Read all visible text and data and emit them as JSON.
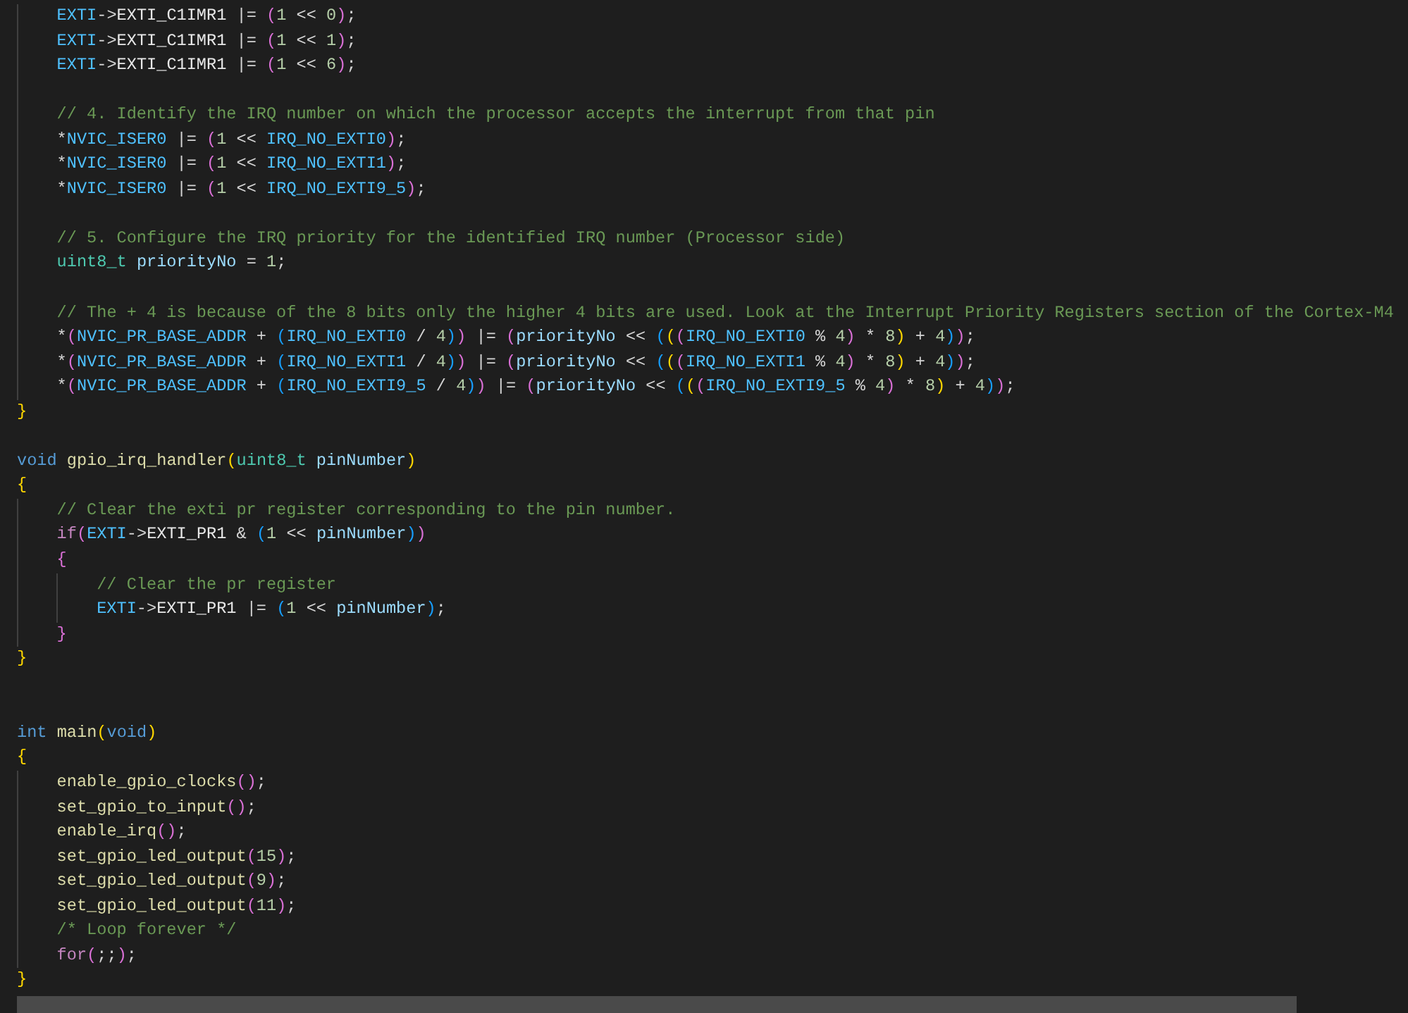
{
  "editor": {
    "lines": [
      {
        "kind": "block",
        "children": [
          {
            "kind": "code",
            "tokens": [
              {
                "text": "EXTI",
                "kind": "mac"
              },
              {
                "text": "->",
                "kind": "op"
              },
              {
                "text": "EXTI_C1IMR1",
                "kind": "fld"
              },
              {
                "text": " |= ",
                "kind": "op"
              },
              {
                "text": "(",
                "kind": "b2"
              },
              {
                "text": "1",
                "kind": "num"
              },
              {
                "text": " << ",
                "kind": "op"
              },
              {
                "text": "0",
                "kind": "num"
              },
              {
                "text": ")",
                "kind": "b2"
              },
              {
                "text": ";",
                "kind": "op"
              }
            ]
          },
          {
            "kind": "code",
            "tokens": [
              {
                "text": "EXTI",
                "kind": "mac"
              },
              {
                "text": "->",
                "kind": "op"
              },
              {
                "text": "EXTI_C1IMR1",
                "kind": "fld"
              },
              {
                "text": " |= ",
                "kind": "op"
              },
              {
                "text": "(",
                "kind": "b2"
              },
              {
                "text": "1",
                "kind": "num"
              },
              {
                "text": " << ",
                "kind": "op"
              },
              {
                "text": "1",
                "kind": "num"
              },
              {
                "text": ")",
                "kind": "b2"
              },
              {
                "text": ";",
                "kind": "op"
              }
            ]
          },
          {
            "kind": "code",
            "tokens": [
              {
                "text": "EXTI",
                "kind": "mac"
              },
              {
                "text": "->",
                "kind": "op"
              },
              {
                "text": "EXTI_C1IMR1",
                "kind": "fld"
              },
              {
                "text": " |= ",
                "kind": "op"
              },
              {
                "text": "(",
                "kind": "b2"
              },
              {
                "text": "1",
                "kind": "num"
              },
              {
                "text": " << ",
                "kind": "op"
              },
              {
                "text": "6",
                "kind": "num"
              },
              {
                "text": ")",
                "kind": "b2"
              },
              {
                "text": ";",
                "kind": "op"
              }
            ]
          },
          {
            "kind": "blank"
          },
          {
            "kind": "code",
            "tokens": [
              {
                "text": "// 4. Identify the IRQ number on which the processor accepts the interrupt from that pin",
                "kind": "cmt"
              }
            ]
          },
          {
            "kind": "code",
            "tokens": [
              {
                "text": "*",
                "kind": "op"
              },
              {
                "text": "NVIC_ISER0",
                "kind": "mac"
              },
              {
                "text": " |= ",
                "kind": "op"
              },
              {
                "text": "(",
                "kind": "b2"
              },
              {
                "text": "1",
                "kind": "num"
              },
              {
                "text": " << ",
                "kind": "op"
              },
              {
                "text": "IRQ_NO_EXTI0",
                "kind": "mac"
              },
              {
                "text": ")",
                "kind": "b2"
              },
              {
                "text": ";",
                "kind": "op"
              }
            ]
          },
          {
            "kind": "code",
            "tokens": [
              {
                "text": "*",
                "kind": "op"
              },
              {
                "text": "NVIC_ISER0",
                "kind": "mac"
              },
              {
                "text": " |= ",
                "kind": "op"
              },
              {
                "text": "(",
                "kind": "b2"
              },
              {
                "text": "1",
                "kind": "num"
              },
              {
                "text": " << ",
                "kind": "op"
              },
              {
                "text": "IRQ_NO_EXTI1",
                "kind": "mac"
              },
              {
                "text": ")",
                "kind": "b2"
              },
              {
                "text": ";",
                "kind": "op"
              }
            ]
          },
          {
            "kind": "code",
            "tokens": [
              {
                "text": "*",
                "kind": "op"
              },
              {
                "text": "NVIC_ISER0",
                "kind": "mac"
              },
              {
                "text": " |= ",
                "kind": "op"
              },
              {
                "text": "(",
                "kind": "b2"
              },
              {
                "text": "1",
                "kind": "num"
              },
              {
                "text": " << ",
                "kind": "op"
              },
              {
                "text": "IRQ_NO_EXTI9_5",
                "kind": "mac"
              },
              {
                "text": ")",
                "kind": "b2"
              },
              {
                "text": ";",
                "kind": "op"
              }
            ]
          },
          {
            "kind": "blank"
          },
          {
            "kind": "code",
            "tokens": [
              {
                "text": "// 5. Configure the IRQ priority for the identified IRQ number (Processor side)",
                "kind": "cmt"
              }
            ]
          },
          {
            "kind": "code",
            "tokens": [
              {
                "text": "uint8_t ",
                "kind": "type"
              },
              {
                "text": "priorityNo",
                "kind": "var"
              },
              {
                "text": " = ",
                "kind": "op"
              },
              {
                "text": "1",
                "kind": "num"
              },
              {
                "text": ";",
                "kind": "op"
              }
            ]
          },
          {
            "kind": "blank"
          },
          {
            "kind": "code",
            "tokens": [
              {
                "text": "// The + 4 is because of the 8 bits only the higher 4 bits are used. Look at the Interrupt Priority Registers section of the Cortex-M4",
                "kind": "cmt"
              }
            ]
          },
          {
            "kind": "code",
            "tokens": [
              {
                "text": "*",
                "kind": "op"
              },
              {
                "text": "(",
                "kind": "b2"
              },
              {
                "text": "NVIC_PR_BASE_ADDR",
                "kind": "mac"
              },
              {
                "text": " + ",
                "kind": "op"
              },
              {
                "text": "(",
                "kind": "b3"
              },
              {
                "text": "IRQ_NO_EXTI0",
                "kind": "mac"
              },
              {
                "text": " / ",
                "kind": "op"
              },
              {
                "text": "4",
                "kind": "num"
              },
              {
                "text": ")",
                "kind": "b3"
              },
              {
                "text": ")",
                "kind": "b2"
              },
              {
                "text": " |= ",
                "kind": "op"
              },
              {
                "text": "(",
                "kind": "b2"
              },
              {
                "text": "priorityNo",
                "kind": "var"
              },
              {
                "text": " << ",
                "kind": "op"
              },
              {
                "text": "(",
                "kind": "b3"
              },
              {
                "text": "(",
                "kind": "b1"
              },
              {
                "text": "(",
                "kind": "b2"
              },
              {
                "text": "IRQ_NO_EXTI0",
                "kind": "mac"
              },
              {
                "text": " % ",
                "kind": "op"
              },
              {
                "text": "4",
                "kind": "num"
              },
              {
                "text": ")",
                "kind": "b2"
              },
              {
                "text": " * ",
                "kind": "op"
              },
              {
                "text": "8",
                "kind": "num"
              },
              {
                "text": ")",
                "kind": "b1"
              },
              {
                "text": " + ",
                "kind": "op"
              },
              {
                "text": "4",
                "kind": "num"
              },
              {
                "text": ")",
                "kind": "b3"
              },
              {
                "text": ")",
                "kind": "b2"
              },
              {
                "text": ";",
                "kind": "op"
              }
            ]
          },
          {
            "kind": "code",
            "tokens": [
              {
                "text": "*",
                "kind": "op"
              },
              {
                "text": "(",
                "kind": "b2"
              },
              {
                "text": "NVIC_PR_BASE_ADDR",
                "kind": "mac"
              },
              {
                "text": " + ",
                "kind": "op"
              },
              {
                "text": "(",
                "kind": "b3"
              },
              {
                "text": "IRQ_NO_EXTI1",
                "kind": "mac"
              },
              {
                "text": " / ",
                "kind": "op"
              },
              {
                "text": "4",
                "kind": "num"
              },
              {
                "text": ")",
                "kind": "b3"
              },
              {
                "text": ")",
                "kind": "b2"
              },
              {
                "text": " |= ",
                "kind": "op"
              },
              {
                "text": "(",
                "kind": "b2"
              },
              {
                "text": "priorityNo",
                "kind": "var"
              },
              {
                "text": " << ",
                "kind": "op"
              },
              {
                "text": "(",
                "kind": "b3"
              },
              {
                "text": "(",
                "kind": "b1"
              },
              {
                "text": "(",
                "kind": "b2"
              },
              {
                "text": "IRQ_NO_EXTI1",
                "kind": "mac"
              },
              {
                "text": " % ",
                "kind": "op"
              },
              {
                "text": "4",
                "kind": "num"
              },
              {
                "text": ")",
                "kind": "b2"
              },
              {
                "text": " * ",
                "kind": "op"
              },
              {
                "text": "8",
                "kind": "num"
              },
              {
                "text": ")",
                "kind": "b1"
              },
              {
                "text": " + ",
                "kind": "op"
              },
              {
                "text": "4",
                "kind": "num"
              },
              {
                "text": ")",
                "kind": "b3"
              },
              {
                "text": ")",
                "kind": "b2"
              },
              {
                "text": ";",
                "kind": "op"
              }
            ]
          },
          {
            "kind": "code",
            "tokens": [
              {
                "text": "*",
                "kind": "op"
              },
              {
                "text": "(",
                "kind": "b2"
              },
              {
                "text": "NVIC_PR_BASE_ADDR",
                "kind": "mac"
              },
              {
                "text": " + ",
                "kind": "op"
              },
              {
                "text": "(",
                "kind": "b3"
              },
              {
                "text": "IRQ_NO_EXTI9_5",
                "kind": "mac"
              },
              {
                "text": " / ",
                "kind": "op"
              },
              {
                "text": "4",
                "kind": "num"
              },
              {
                "text": ")",
                "kind": "b3"
              },
              {
                "text": ")",
                "kind": "b2"
              },
              {
                "text": " |= ",
                "kind": "op"
              },
              {
                "text": "(",
                "kind": "b2"
              },
              {
                "text": "priorityNo",
                "kind": "var"
              },
              {
                "text": " << ",
                "kind": "op"
              },
              {
                "text": "(",
                "kind": "b3"
              },
              {
                "text": "(",
                "kind": "b1"
              },
              {
                "text": "(",
                "kind": "b2"
              },
              {
                "text": "IRQ_NO_EXTI9_5",
                "kind": "mac"
              },
              {
                "text": " % ",
                "kind": "op"
              },
              {
                "text": "4",
                "kind": "num"
              },
              {
                "text": ")",
                "kind": "b2"
              },
              {
                "text": " * ",
                "kind": "op"
              },
              {
                "text": "8",
                "kind": "num"
              },
              {
                "text": ")",
                "kind": "b1"
              },
              {
                "text": " + ",
                "kind": "op"
              },
              {
                "text": "4",
                "kind": "num"
              },
              {
                "text": ")",
                "kind": "b3"
              },
              {
                "text": ")",
                "kind": "b2"
              },
              {
                "text": ";",
                "kind": "op"
              }
            ]
          }
        ]
      },
      {
        "kind": "code",
        "tokens": [
          {
            "text": "}",
            "kind": "b1"
          }
        ]
      },
      {
        "kind": "blank"
      },
      {
        "kind": "code",
        "tokens": [
          {
            "text": "void ",
            "kind": "kw"
          },
          {
            "text": "gpio_irq_handler",
            "kind": "fn"
          },
          {
            "text": "(",
            "kind": "b1"
          },
          {
            "text": "uint8_t ",
            "kind": "type"
          },
          {
            "text": "pinNumber",
            "kind": "var"
          },
          {
            "text": ")",
            "kind": "b1"
          }
        ]
      },
      {
        "kind": "code",
        "tokens": [
          {
            "text": "{",
            "kind": "b1"
          }
        ]
      },
      {
        "kind": "block",
        "children": [
          {
            "kind": "code",
            "tokens": [
              {
                "text": "// Clear the exti pr register corresponding to the pin number.",
                "kind": "cmt"
              }
            ]
          },
          {
            "kind": "code",
            "tokens": [
              {
                "text": "if",
                "kind": "ctl"
              },
              {
                "text": "(",
                "kind": "b2"
              },
              {
                "text": "EXTI",
                "kind": "mac"
              },
              {
                "text": "->",
                "kind": "op"
              },
              {
                "text": "EXTI_PR1",
                "kind": "fld"
              },
              {
                "text": " & ",
                "kind": "op"
              },
              {
                "text": "(",
                "kind": "b3"
              },
              {
                "text": "1",
                "kind": "num"
              },
              {
                "text": " << ",
                "kind": "op"
              },
              {
                "text": "pinNumber",
                "kind": "var"
              },
              {
                "text": ")",
                "kind": "b3"
              },
              {
                "text": ")",
                "kind": "b2"
              }
            ]
          },
          {
            "kind": "code",
            "tokens": [
              {
                "text": "{",
                "kind": "b2"
              }
            ]
          },
          {
            "kind": "block",
            "children": [
              {
                "kind": "code",
                "tokens": [
                  {
                    "text": "// Clear the pr register",
                    "kind": "cmt"
                  }
                ]
              },
              {
                "kind": "code",
                "tokens": [
                  {
                    "text": "EXTI",
                    "kind": "mac"
                  },
                  {
                    "text": "->",
                    "kind": "op"
                  },
                  {
                    "text": "EXTI_PR1",
                    "kind": "fld"
                  },
                  {
                    "text": " |= ",
                    "kind": "op"
                  },
                  {
                    "text": "(",
                    "kind": "b3"
                  },
                  {
                    "text": "1",
                    "kind": "num"
                  },
                  {
                    "text": " << ",
                    "kind": "op"
                  },
                  {
                    "text": "pinNumber",
                    "kind": "var"
                  },
                  {
                    "text": ")",
                    "kind": "b3"
                  },
                  {
                    "text": ";",
                    "kind": "op"
                  }
                ]
              }
            ]
          },
          {
            "kind": "code",
            "tokens": [
              {
                "text": "}",
                "kind": "b2"
              }
            ]
          }
        ]
      },
      {
        "kind": "code",
        "tokens": [
          {
            "text": "}",
            "kind": "b1"
          }
        ]
      },
      {
        "kind": "blank"
      },
      {
        "kind": "blank"
      },
      {
        "kind": "code",
        "tokens": [
          {
            "text": "int ",
            "kind": "kw"
          },
          {
            "text": "main",
            "kind": "fn"
          },
          {
            "text": "(",
            "kind": "b1"
          },
          {
            "text": "void",
            "kind": "kw"
          },
          {
            "text": ")",
            "kind": "b1"
          }
        ]
      },
      {
        "kind": "code",
        "tokens": [
          {
            "text": "{",
            "kind": "b1"
          }
        ]
      },
      {
        "kind": "block",
        "children": [
          {
            "kind": "code",
            "tokens": [
              {
                "text": "enable_gpio_clocks",
                "kind": "fn"
              },
              {
                "text": "()",
                "kind": "b2"
              },
              {
                "text": ";",
                "kind": "op"
              }
            ]
          },
          {
            "kind": "code",
            "tokens": [
              {
                "text": "set_gpio_to_input",
                "kind": "fn"
              },
              {
                "text": "()",
                "kind": "b2"
              },
              {
                "text": ";",
                "kind": "op"
              }
            ]
          },
          {
            "kind": "code",
            "tokens": [
              {
                "text": "enable_irq",
                "kind": "fn"
              },
              {
                "text": "()",
                "kind": "b2"
              },
              {
                "text": ";",
                "kind": "op"
              }
            ]
          },
          {
            "kind": "code",
            "tokens": [
              {
                "text": "set_gpio_led_output",
                "kind": "fn"
              },
              {
                "text": "(",
                "kind": "b2"
              },
              {
                "text": "15",
                "kind": "num"
              },
              {
                "text": ")",
                "kind": "b2"
              },
              {
                "text": ";",
                "kind": "op"
              }
            ]
          },
          {
            "kind": "code",
            "tokens": [
              {
                "text": "set_gpio_led_output",
                "kind": "fn"
              },
              {
                "text": "(",
                "kind": "b2"
              },
              {
                "text": "9",
                "kind": "num"
              },
              {
                "text": ")",
                "kind": "b2"
              },
              {
                "text": ";",
                "kind": "op"
              }
            ]
          },
          {
            "kind": "code",
            "tokens": [
              {
                "text": "set_gpio_led_output",
                "kind": "fn"
              },
              {
                "text": "(",
                "kind": "b2"
              },
              {
                "text": "11",
                "kind": "num"
              },
              {
                "text": ")",
                "kind": "b2"
              },
              {
                "text": ";",
                "kind": "op"
              }
            ]
          },
          {
            "kind": "code",
            "tokens": [
              {
                "text": "/* Loop forever */",
                "kind": "cmt"
              }
            ]
          },
          {
            "kind": "code",
            "tokens": [
              {
                "text": "for",
                "kind": "ctl"
              },
              {
                "text": "(",
                "kind": "b2"
              },
              {
                "text": ";;",
                "kind": "op"
              },
              {
                "text": ")",
                "kind": "b2"
              },
              {
                "text": ";",
                "kind": "op"
              }
            ]
          }
        ]
      },
      {
        "kind": "code",
        "tokens": [
          {
            "text": "}",
            "kind": "b1"
          }
        ]
      }
    ]
  }
}
